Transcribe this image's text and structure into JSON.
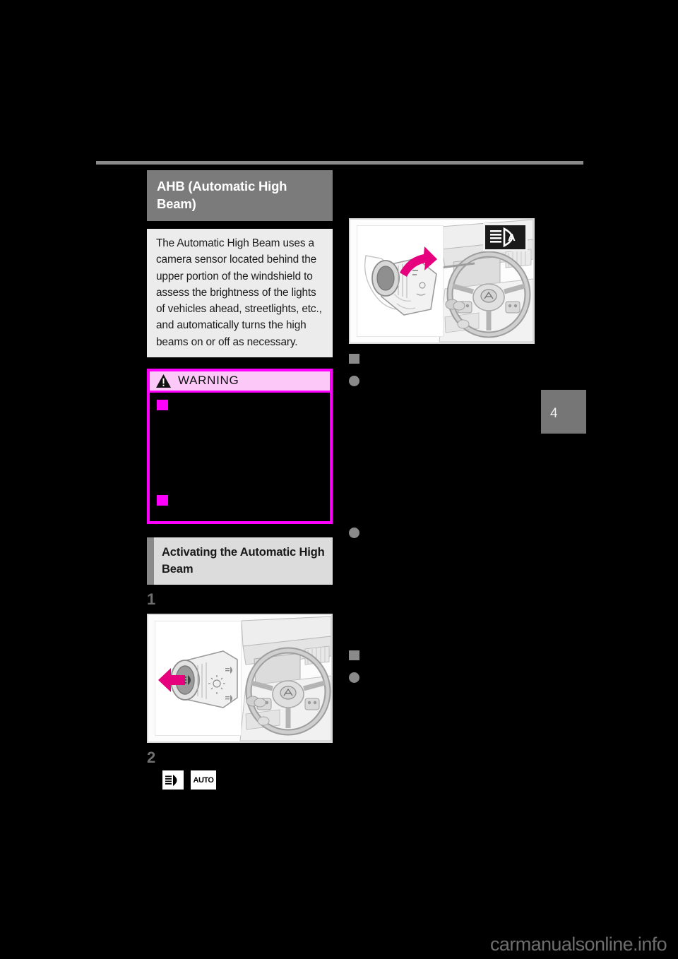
{
  "page": {
    "chapter_number": "4",
    "watermark": "carmanualsonline.info"
  },
  "left_column": {
    "section_title": "AHB (Automatic High Beam)",
    "intro_paragraph": "The Automatic High Beam uses a camera sensor located behind the upper portion of the windshield to assess the brightness of the lights of vehicles ahead, streetlights, etc., and automatically turns the high beams on or off as necessary.",
    "warning": {
      "label": "WARNING",
      "icon": "warning-triangle-icon",
      "items": [
        {
          "text": ""
        },
        {
          "text": ""
        }
      ]
    },
    "subsection": {
      "heading": "Activating the Automatic High Beam",
      "steps": [
        {
          "number": "1",
          "text": ""
        },
        {
          "number": "2",
          "text": ""
        }
      ],
      "step2_symbols": [
        {
          "name": "headlight-beam-icon",
          "label": ""
        },
        {
          "name": "auto-mode-icon",
          "label": "AUTO"
        }
      ]
    },
    "illustration_1": {
      "name": "headlight-switch-dial-illustration",
      "arrow_color": "#e6007e"
    }
  },
  "right_column": {
    "illustration_2": {
      "name": "turn-signal-lever-push-illustration",
      "arrow_color": "#e6007e",
      "indicator": {
        "name": "ahb-indicator-icon",
        "letter": "A"
      }
    },
    "sections": [
      {
        "heading": "",
        "bullets": [
          {
            "text": ""
          },
          {
            "text": ""
          }
        ]
      },
      {
        "heading": "",
        "bullets": [
          {
            "text": ""
          }
        ]
      }
    ]
  },
  "colors": {
    "page_background": "#000000",
    "title_bar": "#7b7b7b",
    "intro_block": "#ececec",
    "warning_border": "#ff00ff",
    "warning_header": "#fbc8f7",
    "bullet_gray": "#8a8a8a",
    "chapter_tab": "#767676",
    "rule": "#8a8a8a"
  }
}
